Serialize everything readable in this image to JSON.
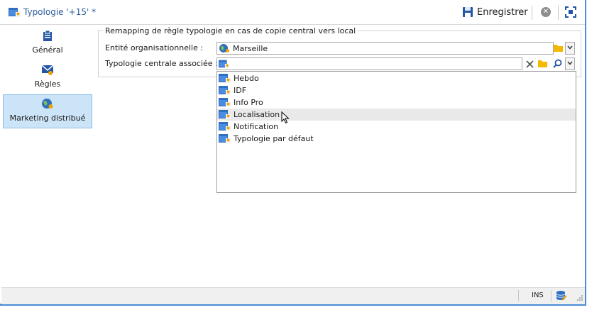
{
  "window": {
    "title": "Typologie '+15' *",
    "save_label": "Enregistrer"
  },
  "sidebar": {
    "items": [
      {
        "label": "Général",
        "icon": "clipboard-icon",
        "active": false
      },
      {
        "label": "Règles",
        "icon": "envelope-icon",
        "active": false
      },
      {
        "label": "Marketing distribué",
        "icon": "globe-icon",
        "active": true
      }
    ]
  },
  "form": {
    "legend": "Remapping de règle typologie en cas de copie central vers local",
    "entity_label": "Entité organisationnelle :",
    "entity_value": "Marseille",
    "typology_label": "Typologie centrale associée :",
    "typology_value": ""
  },
  "dropdown": {
    "items": [
      "Hebdo",
      "IDF",
      "Info Pro",
      "Localisation",
      "Notification",
      "Typologie par défaut"
    ],
    "hovered": "Localisation"
  },
  "status": {
    "mode": "INS"
  },
  "colors": {
    "accent": "#2c5c9e",
    "frame_border": "#4a8bd6",
    "folder": "#f5b800",
    "selected": "#cce4f7"
  }
}
